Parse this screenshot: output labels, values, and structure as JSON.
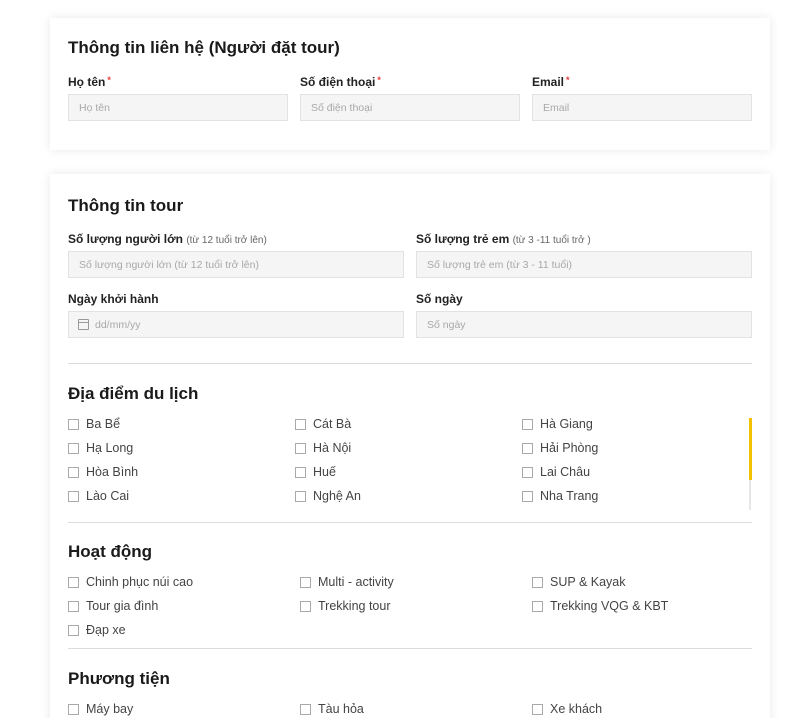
{
  "contact": {
    "title": "Thông tin liên hệ (Người đặt tour)",
    "name_label": "Họ tên",
    "name_placeholder": "Họ tên",
    "phone_label": "Số điện thoại",
    "phone_placeholder": "Số điện thoại",
    "email_label": "Email",
    "email_placeholder": "Email",
    "required_mark": "*"
  },
  "tour": {
    "title": "Thông tin tour",
    "adults_label": "Số lượng người lớn",
    "adults_hint": "(từ 12 tuổi trở lên)",
    "adults_placeholder": "Số lượng người lớn (từ 12 tuổi trở lên)",
    "children_label": "Số lượng trẻ em",
    "children_hint": "(từ 3 -11 tuổi trở )",
    "children_placeholder": "Số lượng trẻ em (từ 3 - 11 tuổi)",
    "date_label": "Ngày khởi hành",
    "date_placeholder": "dd/mm/yy",
    "days_label": "Số ngày",
    "days_placeholder": "Số ngày"
  },
  "destinations": {
    "title": "Địa điểm du lịch",
    "items": [
      "Ba Bể",
      "Cát Bà",
      "Hà Giang",
      "Hạ Long",
      "Hà Nội",
      "Hải Phòng",
      "Hòa Bình",
      "Huế",
      "Lai Châu",
      "Lào Cai",
      "Nghệ An",
      "Nha Trang"
    ]
  },
  "activities": {
    "title": "Hoạt động",
    "items": [
      "Chinh phục núi cao",
      "Multi - activity",
      "SUP & Kayak",
      "Tour gia đình",
      "Trekking tour",
      "Trekking VQG & KBT",
      "Đạp xe"
    ]
  },
  "transport": {
    "title": "Phương tiện",
    "items": [
      "Máy bay",
      "Tàu hỏa",
      "Xe khách"
    ]
  },
  "colors": {
    "accent": "#f2c200",
    "required": "#e53935"
  }
}
